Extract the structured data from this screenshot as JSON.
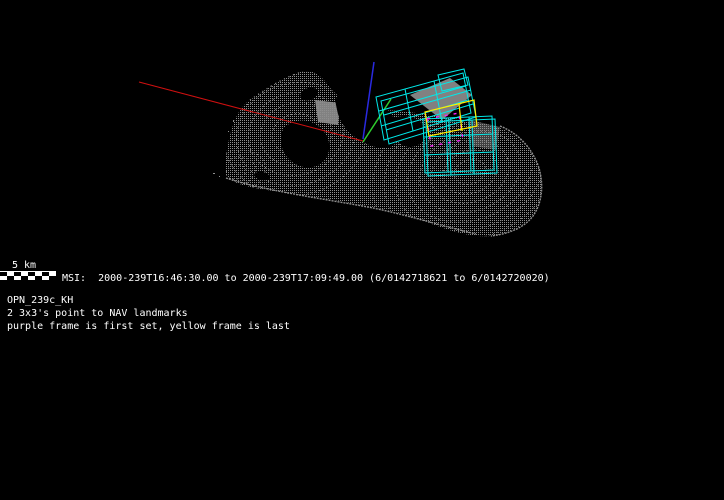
{
  "view": {
    "background": "#000000",
    "text_color": "#ffffff"
  },
  "scale_bar": {
    "label": "5 km"
  },
  "status": {
    "msi_line": "MSI:  2000-239T16:46:30.00 to 2000-239T17:09:49.00 (6/0142718621 to 6/0142720020)"
  },
  "annotations": {
    "sequence_id": "OPN_239c_KH",
    "pointing_note": "2 3x3's point to NAV landmarks",
    "frame_legend": "purple frame is first set, yellow frame is last"
  },
  "scene": {
    "model": "asteroid shape model point cloud with MSI mosaic footprints",
    "colors": {
      "mesh": "#8f8f8f",
      "boresight_red": "#d01010",
      "axis_blue": "#2a2ae0",
      "axis_green": "#2ecc2e",
      "mosaic_frames_cyan": "#00e8e8",
      "last_frame_yellow": "#ffee00",
      "first_frame_purple": "#ff22ff"
    }
  }
}
